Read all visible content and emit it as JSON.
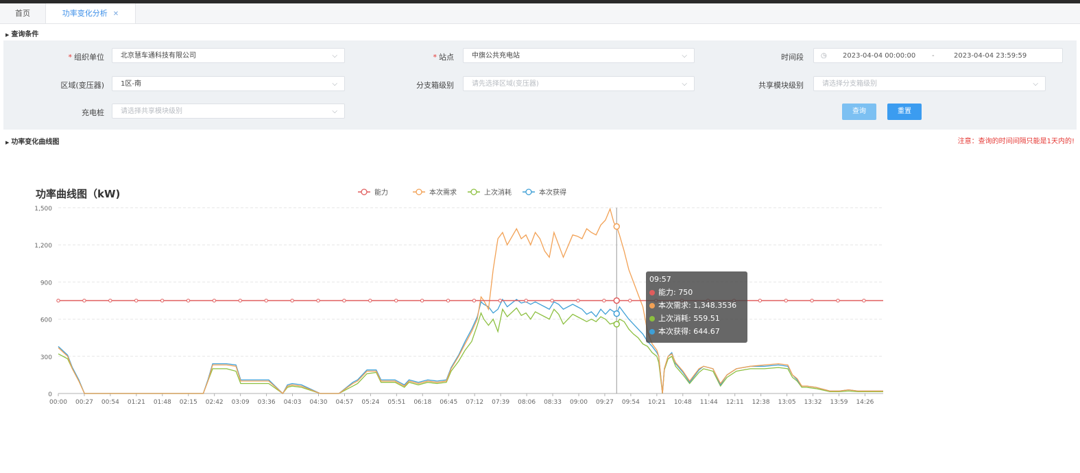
{
  "tabs": {
    "home": "首页",
    "active": "功率变化分析"
  },
  "query_section": {
    "title": "查询条件"
  },
  "filters": {
    "org": {
      "label": "组织单位",
      "value": "北京慧车通科技有限公司"
    },
    "station": {
      "label": "站点",
      "value": "中旗公共充电站"
    },
    "time": {
      "label": "时间段",
      "start": "2023-04-04 00:00:00",
      "sep": "-",
      "end": "2023-04-04 23:59:59"
    },
    "area": {
      "label": "区域(变压器)",
      "value": "1区-南"
    },
    "branch": {
      "label": "分支箱级别",
      "placeholder": "请先选择区域(变压器)"
    },
    "shared": {
      "label": "共享模块级别",
      "placeholder": "请选择分支箱级别"
    },
    "pile": {
      "label": "充电桩",
      "placeholder": "请选择共享模块级别"
    },
    "buttons": {
      "query": "查询",
      "reset": "重置"
    }
  },
  "chart_section": {
    "title": "功率变化曲线图",
    "notice": "注意：查询的时间间隔只能是1天内的!"
  },
  "colors": {
    "capacity": "#e05c5c",
    "demand": "#f2a155",
    "last": "#8cbf3f",
    "obtained": "#3e9fd6"
  },
  "chart_data": {
    "type": "line",
    "title": "功率曲线图（kW)",
    "ylim": [
      0,
      1500
    ],
    "yticks": [
      "0",
      "300",
      "600",
      "900",
      "1,200",
      "1,500"
    ],
    "xticks": [
      "00:00",
      "00:27",
      "00:54",
      "01:21",
      "01:48",
      "02:15",
      "02:42",
      "03:09",
      "03:36",
      "04:03",
      "04:30",
      "04:57",
      "05:24",
      "05:51",
      "06:18",
      "06:45",
      "07:12",
      "07:39",
      "08:06",
      "08:33",
      "09:00",
      "09:27",
      "09:54",
      "10:21",
      "10:48",
      "11:44",
      "12:11",
      "12:38",
      "13:05",
      "13:32",
      "13:59",
      "14:26"
    ],
    "x": [
      "00:00",
      "00:10",
      "00:15",
      "00:22",
      "00:28",
      "00:35",
      "00:45",
      "01:00",
      "01:30",
      "02:00",
      "02:20",
      "02:35",
      "02:40",
      "02:45",
      "03:00",
      "03:10",
      "03:15",
      "03:30",
      "03:45",
      "04:00",
      "04:05",
      "04:10",
      "04:20",
      "04:40",
      "04:50",
      "05:00",
      "05:15",
      "05:20",
      "05:30",
      "05:40",
      "05:45",
      "06:00",
      "06:10",
      "06:15",
      "06:25",
      "06:35",
      "06:45",
      "06:55",
      "07:00",
      "07:08",
      "07:15",
      "07:22",
      "07:28",
      "07:32",
      "07:35",
      "07:40",
      "07:45",
      "07:50",
      "07:55",
      "08:00",
      "08:10",
      "08:15",
      "08:20",
      "08:25",
      "08:30",
      "08:35",
      "08:40",
      "08:45",
      "08:50",
      "08:55",
      "09:00",
      "09:10",
      "09:15",
      "09:20",
      "09:25",
      "09:30",
      "09:35",
      "09:40",
      "09:45",
      "09:50",
      "09:54",
      "09:57",
      "10:00",
      "10:05",
      "10:10",
      "10:15",
      "10:20",
      "10:25",
      "10:30",
      "10:35",
      "10:40",
      "10:42",
      "10:46",
      "10:48",
      "10:52",
      "10:56",
      "11:00",
      "11:08",
      "11:15",
      "11:25",
      "11:30",
      "11:40",
      "11:48",
      "11:55",
      "12:05",
      "12:20",
      "12:35",
      "12:50",
      "13:00",
      "13:05",
      "13:10",
      "13:15",
      "13:20",
      "13:30",
      "13:45",
      "13:55",
      "14:05",
      "14:15",
      "14:25",
      "14:35",
      "14:42"
    ],
    "series": [
      {
        "name": "能力",
        "values": [
          750,
          750,
          750,
          750,
          750,
          750,
          750,
          750,
          750,
          750,
          750,
          750,
          750,
          750,
          750,
          750,
          750,
          750,
          750,
          750,
          750,
          750,
          750,
          750,
          750,
          750,
          750,
          750,
          750,
          750,
          750,
          750,
          750,
          750,
          750,
          750,
          750,
          750,
          750,
          750,
          750,
          750,
          750,
          750,
          750,
          750,
          750,
          750,
          750,
          750,
          750,
          750,
          750,
          750,
          750,
          750,
          750,
          750,
          750,
          750,
          750,
          750,
          750,
          750,
          750,
          750,
          750,
          750,
          750,
          750,
          750,
          750,
          750,
          750,
          750,
          750,
          750,
          750,
          750,
          750,
          750,
          750,
          750,
          750,
          750,
          750,
          750,
          750,
          750,
          750,
          750,
          750,
          750,
          750,
          750,
          750,
          750,
          750,
          750,
          750,
          750,
          750,
          750,
          750,
          750,
          750,
          750,
          750,
          750,
          750,
          750
        ]
      },
      {
        "name": "本次需求",
        "values": [
          370,
          300,
          200,
          100,
          0,
          0,
          0,
          0,
          0,
          0,
          0,
          0,
          100,
          230,
          230,
          220,
          100,
          100,
          100,
          0,
          60,
          70,
          60,
          0,
          0,
          0,
          80,
          100,
          180,
          180,
          100,
          100,
          60,
          100,
          80,
          100,
          90,
          100,
          200,
          300,
          400,
          500,
          600,
          780,
          750,
          680,
          1000,
          1250,
          1300,
          1200,
          1330,
          1250,
          1280,
          1200,
          1300,
          1250,
          1150,
          1100,
          1300,
          1200,
          1100,
          1280,
          1270,
          1250,
          1330,
          1300,
          1280,
          1360,
          1400,
          1490,
          1380,
          1348.35,
          1280,
          1150,
          1000,
          900,
          800,
          700,
          500,
          400,
          350,
          300,
          0,
          200,
          300,
          320,
          250,
          180,
          100,
          200,
          220,
          200,
          80,
          150,
          200,
          220,
          230,
          240,
          230,
          150,
          120,
          60,
          60,
          50,
          20,
          20,
          30,
          20,
          20,
          20,
          20
        ]
      },
      {
        "name": "上次消耗",
        "values": [
          320,
          280,
          200,
          100,
          0,
          0,
          0,
          0,
          0,
          0,
          0,
          0,
          100,
          200,
          200,
          180,
          80,
          80,
          80,
          0,
          50,
          60,
          50,
          0,
          0,
          0,
          60,
          80,
          160,
          170,
          90,
          90,
          50,
          90,
          70,
          90,
          80,
          90,
          180,
          260,
          350,
          420,
          550,
          650,
          600,
          550,
          600,
          500,
          680,
          620,
          690,
          630,
          650,
          600,
          660,
          640,
          620,
          600,
          680,
          640,
          560,
          640,
          620,
          600,
          580,
          600,
          580,
          620,
          600,
          560,
          570,
          559.51,
          600,
          580,
          520,
          480,
          450,
          400,
          380,
          330,
          300,
          250,
          0,
          190,
          280,
          300,
          220,
          150,
          80,
          170,
          200,
          180,
          60,
          130,
          180,
          200,
          200,
          210,
          200,
          130,
          100,
          50,
          50,
          40,
          15,
          15,
          20,
          15,
          15,
          15,
          15
        ]
      },
      {
        "name": "本次获得",
        "values": [
          380,
          310,
          210,
          110,
          0,
          0,
          0,
          0,
          0,
          0,
          0,
          0,
          110,
          240,
          240,
          230,
          110,
          110,
          110,
          0,
          70,
          80,
          70,
          0,
          0,
          0,
          90,
          110,
          190,
          190,
          110,
          110,
          70,
          110,
          90,
          110,
          100,
          110,
          210,
          310,
          420,
          520,
          620,
          740,
          720,
          700,
          650,
          680,
          760,
          700,
          760,
          730,
          740,
          720,
          740,
          720,
          700,
          680,
          740,
          720,
          680,
          720,
          700,
          680,
          640,
          660,
          620,
          680,
          640,
          680,
          660,
          644.67,
          700,
          650,
          600,
          560,
          520,
          480,
          420,
          380,
          330,
          300,
          0,
          200,
          300,
          330,
          240,
          170,
          90,
          190,
          220,
          200,
          70,
          150,
          200,
          220,
          220,
          230,
          220,
          150,
          110,
          60,
          60,
          50,
          20,
          20,
          30,
          20,
          20,
          20,
          20
        ]
      }
    ],
    "tooltip": {
      "time": "09:57",
      "rows": [
        {
          "name": "能力",
          "value": "750"
        },
        {
          "name": "本次需求",
          "value": "1,348.3536"
        },
        {
          "name": "上次消耗",
          "value": "559.51"
        },
        {
          "name": "本次获得",
          "value": "644.67"
        }
      ]
    },
    "legend": "top-center",
    "grid": true
  }
}
